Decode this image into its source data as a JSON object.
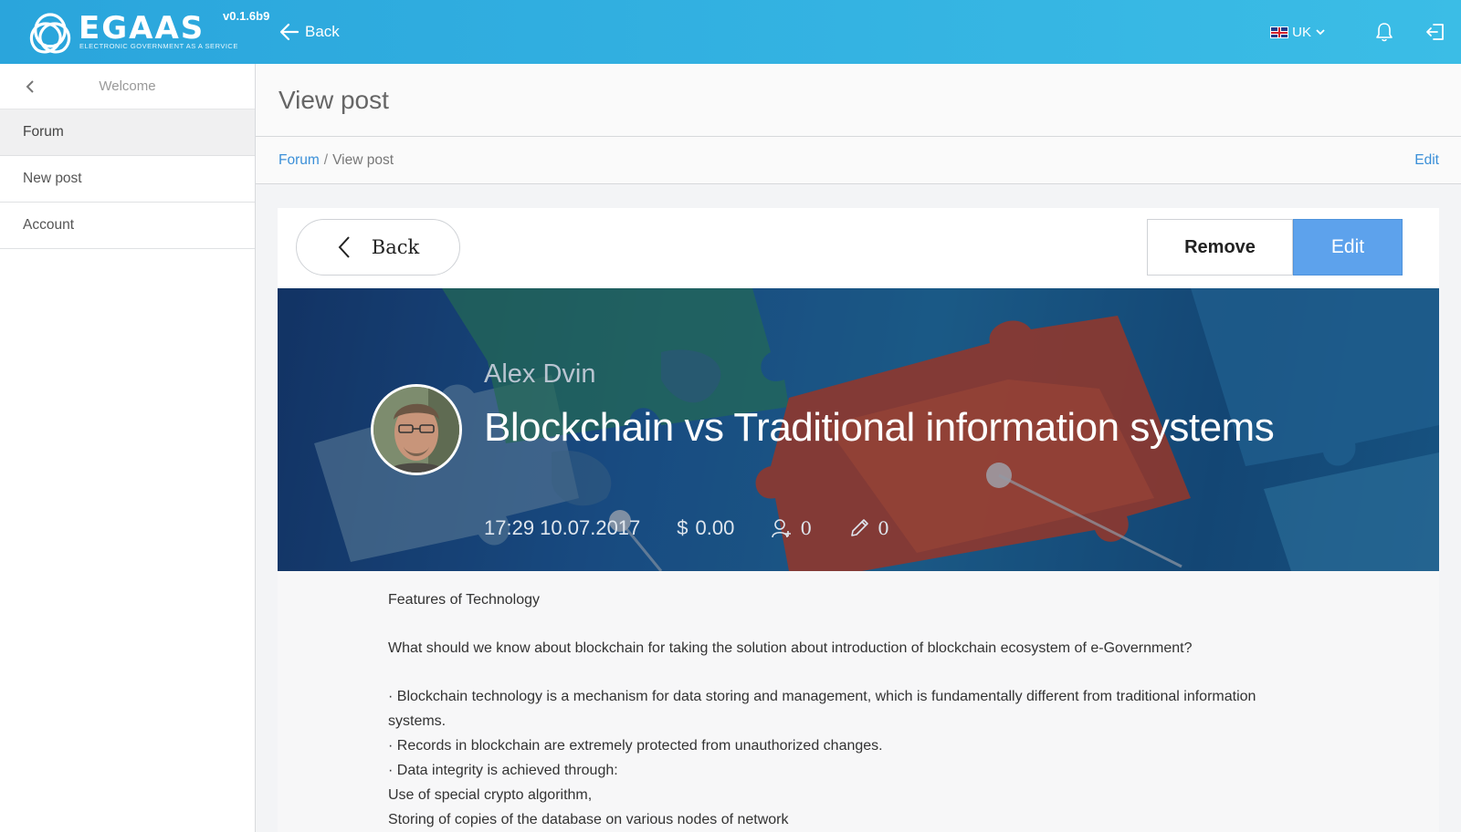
{
  "topbar": {
    "logo_word": "EGAAS",
    "logo_tagline": "ELECTRONIC GOVERNMENT AS A SERVICE",
    "version": "v0.1.6b9",
    "back_label": "Back",
    "language": "UK",
    "icons": {
      "bell": "bell-icon",
      "logout": "logout-icon"
    }
  },
  "sidebar": {
    "title": "Welcome",
    "items": [
      {
        "label": "Forum",
        "active": true
      },
      {
        "label": "New post",
        "active": false
      },
      {
        "label": "Account",
        "active": false
      }
    ]
  },
  "page": {
    "title": "View post",
    "breadcrumb": {
      "link": "Forum",
      "separator": "/",
      "current": "View post"
    },
    "edit_link": "Edit"
  },
  "toolbar": {
    "back_label": "Back",
    "remove_label": "Remove",
    "edit_label": "Edit"
  },
  "post": {
    "author": "Alex Dvin",
    "title": "Blockchain vs Traditional information systems",
    "datetime": "17:29 10.07.2017",
    "currency_symbol": "$",
    "amount": "0.00",
    "followers": "0",
    "edits": "0",
    "body": {
      "heading": "Features of Technology",
      "question": "What should we know about blockchain for taking the solution about introduction of blockchain ecosystem of e-Government?",
      "line1": "· Blockchain technology is a mechanism for data storing and management, which is fundamentally different from traditional information systems.",
      "line2": "· Records in blockchain are extremely protected from unauthorized changes.",
      "line3": "· Data integrity is achieved through:",
      "line4": "Use of special crypto algorithm,",
      "line5": "Storing of copies of the database on various nodes of network"
    }
  },
  "colors": {
    "topbar": "#2aa5dc",
    "accent": "#3a8fd8",
    "edit_button": "#5da2ec"
  }
}
